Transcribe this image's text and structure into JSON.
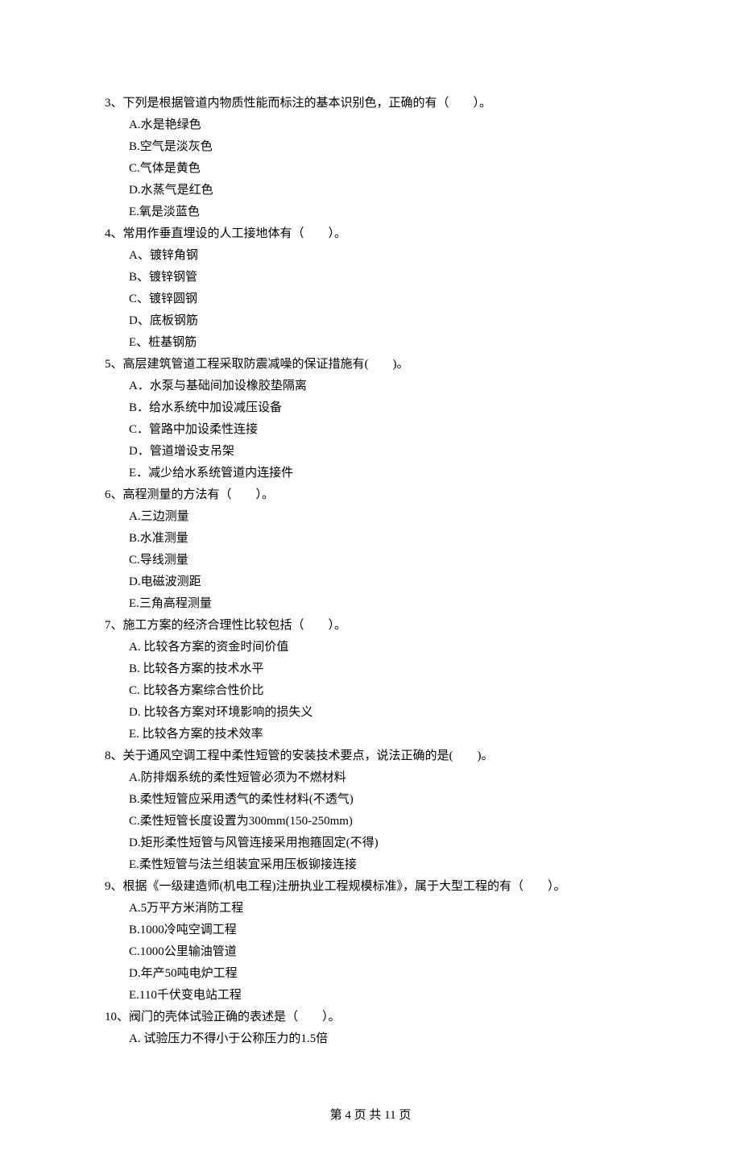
{
  "questions": [
    {
      "num": "3、",
      "stem": "下列是根据管道内物质性能而标注的基本识别色，正确的有（　　）。",
      "options": [
        "A.水是艳绿色",
        "B.空气是淡灰色",
        "C.气体是黄色",
        "D.水蒸气是红色",
        "E.氧是淡蓝色"
      ]
    },
    {
      "num": "4、",
      "stem": "常用作垂直埋设的人工接地体有（　　）。",
      "options": [
        "A、镀锌角钢",
        "B、镀锌钢管",
        "C、镀锌圆钢",
        "D、底板钢筋",
        "E、桩基钢筋"
      ]
    },
    {
      "num": "5、",
      "stem": "高层建筑管道工程采取防震减噪的保证措施有(　　)。",
      "options": [
        "A．水泵与基础间加设橡胶垫隔离",
        "B．给水系统中加设减压设备",
        "C．管路中加设柔性连接",
        "D．管道增设支吊架",
        "E．减少给水系统管道内连接件"
      ]
    },
    {
      "num": "6、",
      "stem": "高程测量的方法有（　　）。",
      "options": [
        "A.三边测量",
        "B.水准测量",
        "C.导线测量",
        "D.电磁波测距",
        "E.三角高程测量"
      ]
    },
    {
      "num": "7、",
      "stem": "施工方案的经济合理性比较包括（　　）。",
      "options": [
        "A. 比较各方案的资金时间价值",
        "B. 比较各方案的技术水平",
        "C. 比较各方案综合性价比",
        "D. 比较各方案对环境影响的损失义",
        "E. 比较各方案的技术效率"
      ]
    },
    {
      "num": "8、",
      "stem": "关于通风空调工程中柔性短管的安装技术要点，说法正确的是(　　)。",
      "options": [
        "A.防排烟系统的柔性短管必须为不燃材料",
        "B.柔性短管应采用透气的柔性材料(不透气)",
        "C.柔性短管长度设置为300mm(150-250mm)",
        "D.矩形柔性短管与风管连接采用抱箍固定(不得)",
        "E.柔性短管与法兰组装宜采用压板铆接连接"
      ]
    },
    {
      "num": "9、",
      "stem": "根据《一级建造师(机电工程)注册执业工程规模标准》，属于大型工程的有（　　）。",
      "options": [
        "A.5万平方米消防工程",
        "B.1000冷吨空调工程",
        "C.1000公里输油管道",
        "D.年产50吨电炉工程",
        "E.110千伏变电站工程"
      ]
    },
    {
      "num": "10、",
      "stem": "阀门的壳体试验正确的表述是（　　）。",
      "options": [
        "A. 试验压力不得小于公称压力的1.5倍"
      ]
    }
  ],
  "footer": "第 4 页 共 11 页"
}
